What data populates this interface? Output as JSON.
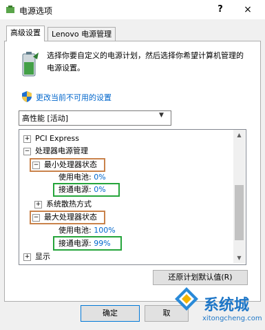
{
  "window": {
    "title": "电源选项",
    "help_glyph": "?",
    "close_glyph": "×"
  },
  "tabs": [
    {
      "label": "高级设置",
      "active": true
    },
    {
      "label": "Lenovo 电源管理",
      "active": false
    }
  ],
  "intro": {
    "text": "选择你要自定义的电源计划，然后选择你希望计算机管理的电源设置。"
  },
  "change_link": {
    "label": "更改当前不可用的设置"
  },
  "plan_select": {
    "value": "高性能 [活动]"
  },
  "tree": {
    "pci": {
      "label": "PCI Express",
      "toggle": "+"
    },
    "cpu_mgmt": {
      "label": "处理器电源管理",
      "toggle": "−"
    },
    "min_state": {
      "label": "最小处理器状态",
      "toggle": "−"
    },
    "min_battery": {
      "label": "使用电池:",
      "value": "0%"
    },
    "min_plugged": {
      "label": "接通电源:",
      "value": "0%"
    },
    "cooling": {
      "label": "系统散热方式",
      "toggle": "+"
    },
    "max_state": {
      "label": "最大处理器状态",
      "toggle": "−"
    },
    "max_battery": {
      "label": "使用电池:",
      "value": "100%"
    },
    "max_plugged": {
      "label": "接通电源:",
      "value": "99%"
    },
    "display": {
      "label": "显示",
      "toggle": "+"
    }
  },
  "buttons": {
    "restore": "还原计划默认值(R)",
    "ok": "确定",
    "cancel": "取"
  },
  "watermark": {
    "brand": "系统城",
    "url": "xitongcheng.com"
  },
  "colors": {
    "link": "#0066cc",
    "highlight_orange": "#c9824a",
    "highlight_green": "#24a43a"
  }
}
